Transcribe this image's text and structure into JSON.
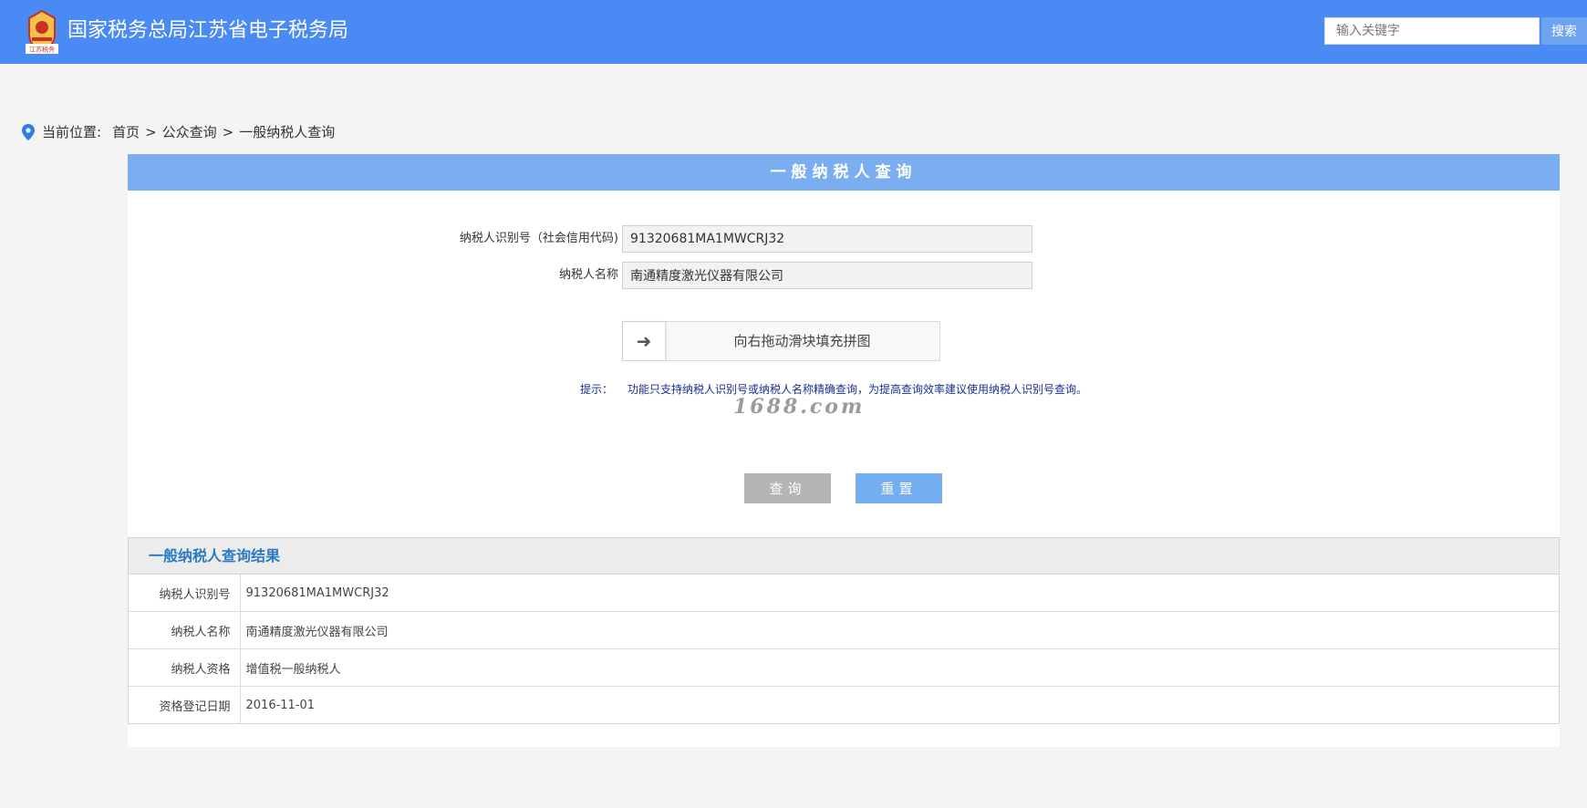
{
  "header": {
    "emblem_text": "江苏税务",
    "title": "国家税务总局江苏省电子税务局",
    "search_placeholder": "输入关键字",
    "search_label": "搜索"
  },
  "breadcrumb": {
    "label": "当前位置:",
    "items": [
      "首页",
      "公众查询",
      "一般纳税人查询"
    ],
    "separator": ">"
  },
  "panel": {
    "title": "一般纳税人查询"
  },
  "form": {
    "taxpayer_id_label": "纳税人识别号（社会信用代码)",
    "taxpayer_id_value": "91320681MA1MWCRJ32",
    "taxpayer_name_label": "纳税人名称",
    "taxpayer_name_value": "南通精度激光仪器有限公司",
    "slider_text": "向右拖动滑块填充拼图",
    "tip_label": "提示：",
    "tip_text": "功能只支持纳税人识别号或纳税人名称精确查询，为提高查询效率建议使用纳税人识别号查询。",
    "watermark": "1688.com",
    "query_label": "查询",
    "reset_label": "重置"
  },
  "result": {
    "title": "一般纳税人查询结果",
    "rows": [
      {
        "key": "纳税人识别号",
        "value": "91320681MA1MWCRJ32"
      },
      {
        "key": "纳税人名称",
        "value": "南通精度激光仪器有限公司"
      },
      {
        "key": "纳税人资格",
        "value": "增值税一般纳税人"
      },
      {
        "key": "资格登记日期",
        "value": "2016-11-01"
      }
    ]
  },
  "colors": {
    "header_bg": "#4a8af4",
    "panel_header_bg": "#7aaef0",
    "result_title": "#2a7bc2",
    "tip_text": "#1b2f8f",
    "query_button": "#b5b5b5",
    "reset_button": "#75aef0"
  },
  "icons": {
    "emblem": "tax-emblem-icon",
    "location": "location-pin-icon",
    "slider_arrow": "arrow-right-icon"
  }
}
